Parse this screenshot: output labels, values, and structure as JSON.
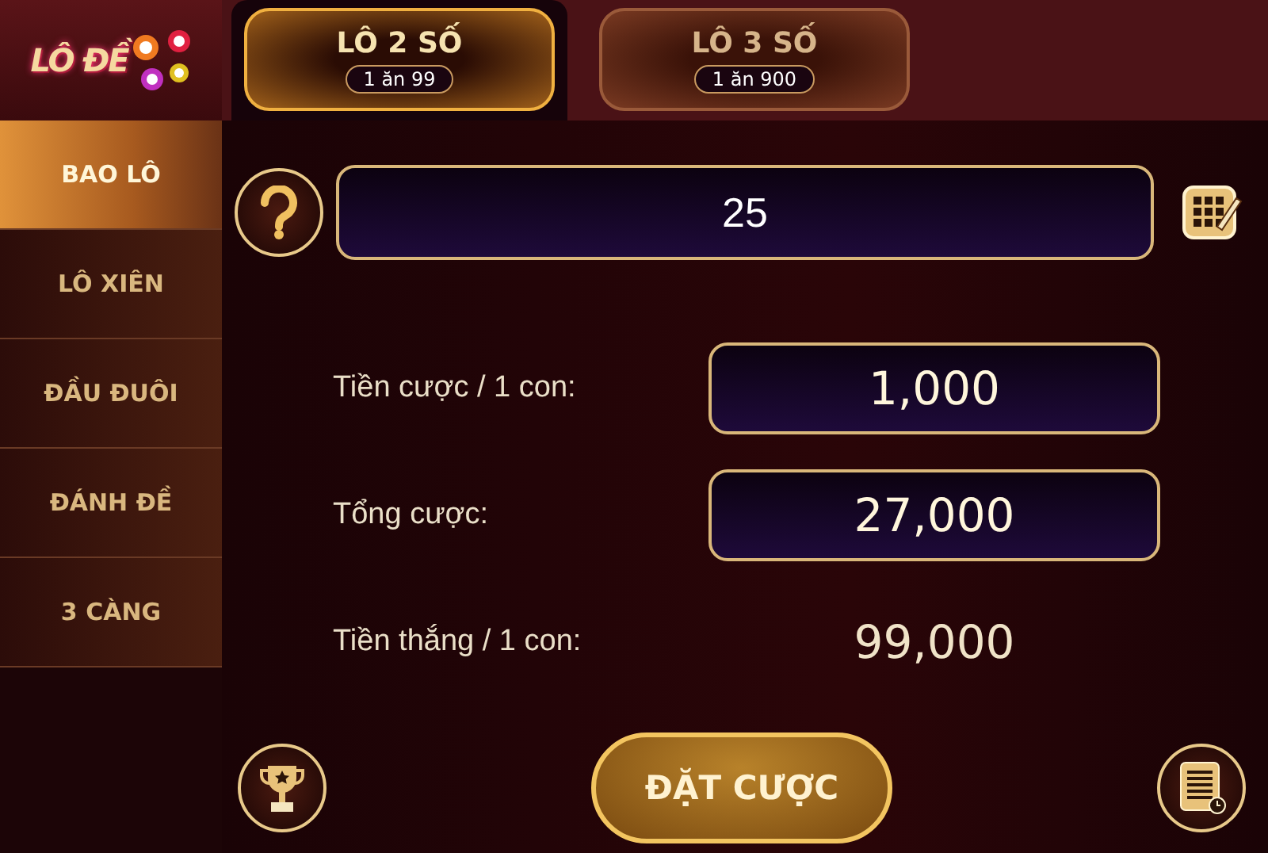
{
  "logo": {
    "text": "LÔ ĐỀ"
  },
  "tabs": [
    {
      "title": "LÔ 2 SỐ",
      "odds": "1 ăn 99",
      "selected": true
    },
    {
      "title": "LÔ 3 SỐ",
      "odds": "1 ăn 900",
      "selected": false
    }
  ],
  "sidebar": {
    "items": [
      {
        "label": "BAO LÔ",
        "selected": true
      },
      {
        "label": "LÔ XIÊN",
        "selected": false
      },
      {
        "label": "ĐẦU ĐUÔI",
        "selected": false
      },
      {
        "label": "ĐÁNH ĐỀ",
        "selected": false
      },
      {
        "label": "3 CÀNG",
        "selected": false
      }
    ]
  },
  "number_input": {
    "value": "25"
  },
  "rows": [
    {
      "kind": "field",
      "label": "Tiền cược / 1 con:",
      "value": "1,000"
    },
    {
      "kind": "field",
      "label": "Tổng cược:",
      "value": "27,000"
    },
    {
      "kind": "text",
      "label": "Tiền thắng / 1 con:",
      "value": "99,000"
    }
  ],
  "bet_button": {
    "label": "ĐẶT CƯỢC"
  }
}
